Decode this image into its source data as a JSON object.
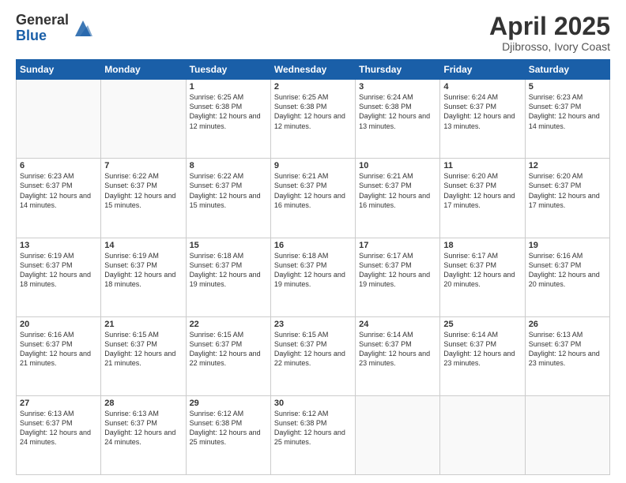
{
  "header": {
    "logo_general": "General",
    "logo_blue": "Blue",
    "title": "April 2025",
    "subtitle": "Djibrosso, Ivory Coast"
  },
  "days_of_week": [
    "Sunday",
    "Monday",
    "Tuesday",
    "Wednesday",
    "Thursday",
    "Friday",
    "Saturday"
  ],
  "weeks": [
    [
      {
        "day": "",
        "info": ""
      },
      {
        "day": "",
        "info": ""
      },
      {
        "day": "1",
        "info": "Sunrise: 6:25 AM\nSunset: 6:38 PM\nDaylight: 12 hours and 12 minutes."
      },
      {
        "day": "2",
        "info": "Sunrise: 6:25 AM\nSunset: 6:38 PM\nDaylight: 12 hours and 12 minutes."
      },
      {
        "day": "3",
        "info": "Sunrise: 6:24 AM\nSunset: 6:38 PM\nDaylight: 12 hours and 13 minutes."
      },
      {
        "day": "4",
        "info": "Sunrise: 6:24 AM\nSunset: 6:37 PM\nDaylight: 12 hours and 13 minutes."
      },
      {
        "day": "5",
        "info": "Sunrise: 6:23 AM\nSunset: 6:37 PM\nDaylight: 12 hours and 14 minutes."
      }
    ],
    [
      {
        "day": "6",
        "info": "Sunrise: 6:23 AM\nSunset: 6:37 PM\nDaylight: 12 hours and 14 minutes."
      },
      {
        "day": "7",
        "info": "Sunrise: 6:22 AM\nSunset: 6:37 PM\nDaylight: 12 hours and 15 minutes."
      },
      {
        "day": "8",
        "info": "Sunrise: 6:22 AM\nSunset: 6:37 PM\nDaylight: 12 hours and 15 minutes."
      },
      {
        "day": "9",
        "info": "Sunrise: 6:21 AM\nSunset: 6:37 PM\nDaylight: 12 hours and 16 minutes."
      },
      {
        "day": "10",
        "info": "Sunrise: 6:21 AM\nSunset: 6:37 PM\nDaylight: 12 hours and 16 minutes."
      },
      {
        "day": "11",
        "info": "Sunrise: 6:20 AM\nSunset: 6:37 PM\nDaylight: 12 hours and 17 minutes."
      },
      {
        "day": "12",
        "info": "Sunrise: 6:20 AM\nSunset: 6:37 PM\nDaylight: 12 hours and 17 minutes."
      }
    ],
    [
      {
        "day": "13",
        "info": "Sunrise: 6:19 AM\nSunset: 6:37 PM\nDaylight: 12 hours and 18 minutes."
      },
      {
        "day": "14",
        "info": "Sunrise: 6:19 AM\nSunset: 6:37 PM\nDaylight: 12 hours and 18 minutes."
      },
      {
        "day": "15",
        "info": "Sunrise: 6:18 AM\nSunset: 6:37 PM\nDaylight: 12 hours and 19 minutes."
      },
      {
        "day": "16",
        "info": "Sunrise: 6:18 AM\nSunset: 6:37 PM\nDaylight: 12 hours and 19 minutes."
      },
      {
        "day": "17",
        "info": "Sunrise: 6:17 AM\nSunset: 6:37 PM\nDaylight: 12 hours and 19 minutes."
      },
      {
        "day": "18",
        "info": "Sunrise: 6:17 AM\nSunset: 6:37 PM\nDaylight: 12 hours and 20 minutes."
      },
      {
        "day": "19",
        "info": "Sunrise: 6:16 AM\nSunset: 6:37 PM\nDaylight: 12 hours and 20 minutes."
      }
    ],
    [
      {
        "day": "20",
        "info": "Sunrise: 6:16 AM\nSunset: 6:37 PM\nDaylight: 12 hours and 21 minutes."
      },
      {
        "day": "21",
        "info": "Sunrise: 6:15 AM\nSunset: 6:37 PM\nDaylight: 12 hours and 21 minutes."
      },
      {
        "day": "22",
        "info": "Sunrise: 6:15 AM\nSunset: 6:37 PM\nDaylight: 12 hours and 22 minutes."
      },
      {
        "day": "23",
        "info": "Sunrise: 6:15 AM\nSunset: 6:37 PM\nDaylight: 12 hours and 22 minutes."
      },
      {
        "day": "24",
        "info": "Sunrise: 6:14 AM\nSunset: 6:37 PM\nDaylight: 12 hours and 23 minutes."
      },
      {
        "day": "25",
        "info": "Sunrise: 6:14 AM\nSunset: 6:37 PM\nDaylight: 12 hours and 23 minutes."
      },
      {
        "day": "26",
        "info": "Sunrise: 6:13 AM\nSunset: 6:37 PM\nDaylight: 12 hours and 23 minutes."
      }
    ],
    [
      {
        "day": "27",
        "info": "Sunrise: 6:13 AM\nSunset: 6:37 PM\nDaylight: 12 hours and 24 minutes."
      },
      {
        "day": "28",
        "info": "Sunrise: 6:13 AM\nSunset: 6:37 PM\nDaylight: 12 hours and 24 minutes."
      },
      {
        "day": "29",
        "info": "Sunrise: 6:12 AM\nSunset: 6:38 PM\nDaylight: 12 hours and 25 minutes."
      },
      {
        "day": "30",
        "info": "Sunrise: 6:12 AM\nSunset: 6:38 PM\nDaylight: 12 hours and 25 minutes."
      },
      {
        "day": "",
        "info": ""
      },
      {
        "day": "",
        "info": ""
      },
      {
        "day": "",
        "info": ""
      }
    ]
  ]
}
